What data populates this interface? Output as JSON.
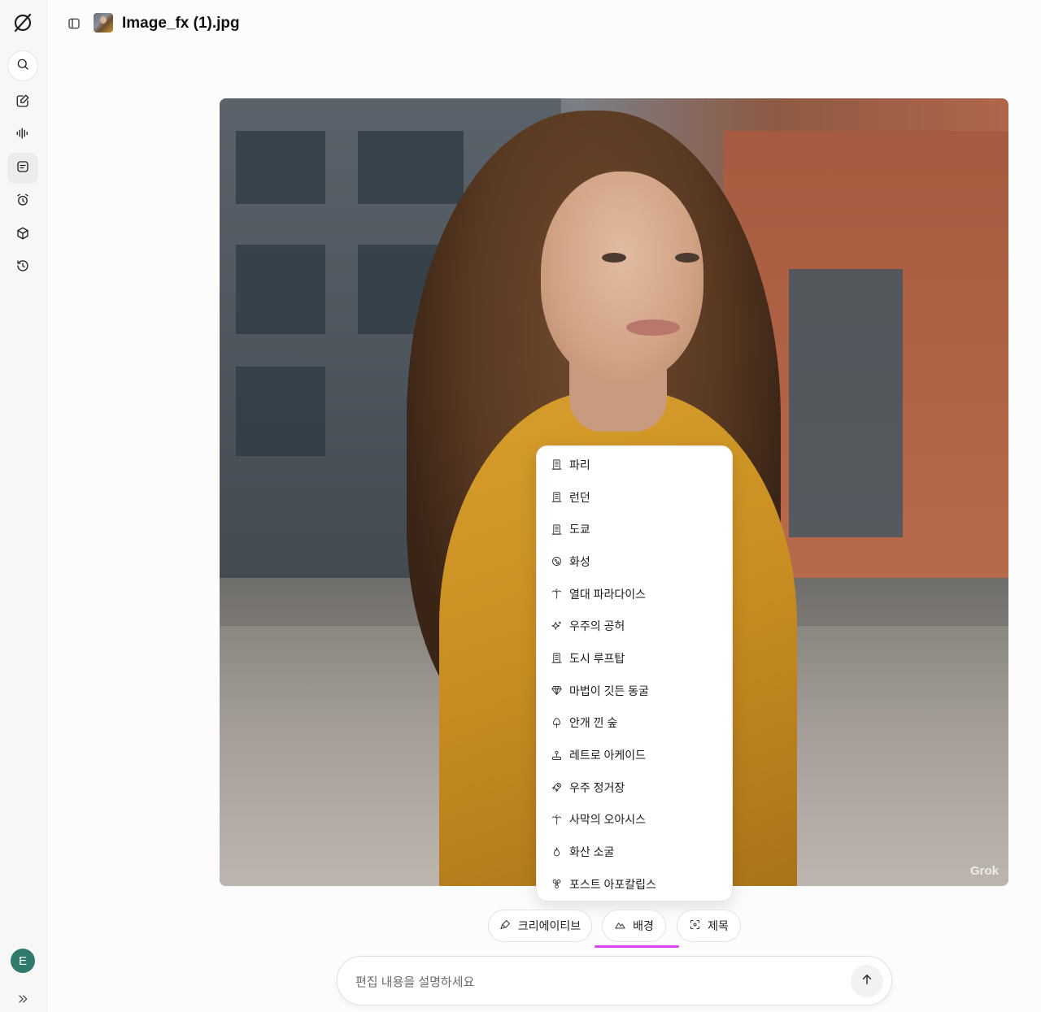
{
  "header": {
    "filename": "Image_fx (1).jpg"
  },
  "sidebar": {
    "icons": [
      "grok-logo-icon",
      "search-icon",
      "edit-icon",
      "voice-icon",
      "chat-icon",
      "alarm-icon",
      "cube-icon",
      "history-icon"
    ],
    "avatar_initial": "E"
  },
  "image": {
    "watermark": "Grok"
  },
  "background_menu": {
    "items": [
      {
        "label": "파리",
        "icon": "building-icon"
      },
      {
        "label": "런던",
        "icon": "building-icon"
      },
      {
        "label": "도쿄",
        "icon": "building-icon"
      },
      {
        "label": "화성",
        "icon": "planet-icon"
      },
      {
        "label": "열대 파라다이스",
        "icon": "palm-tree-icon"
      },
      {
        "label": "우주의 공허",
        "icon": "sparkles-icon"
      },
      {
        "label": "도시 루프탑",
        "icon": "building-icon"
      },
      {
        "label": "마법이 깃든 동굴",
        "icon": "gem-icon"
      },
      {
        "label": "안개 낀 숲",
        "icon": "tree-icon"
      },
      {
        "label": "레트로 아케이드",
        "icon": "joystick-icon"
      },
      {
        "label": "우주 정거장",
        "icon": "rocket-icon"
      },
      {
        "label": "사막의 오아시스",
        "icon": "palm-tree-icon"
      },
      {
        "label": "화산 소굴",
        "icon": "flame-icon"
      },
      {
        "label": "포스트 아포칼립스",
        "icon": "biohazard-icon"
      }
    ]
  },
  "modes": {
    "creative": "크리에이티브",
    "background": "배경",
    "title": "제목",
    "active": "background",
    "active_color": "#d946ef"
  },
  "prompt": {
    "placeholder": "편집 내용을 설명하세요"
  }
}
